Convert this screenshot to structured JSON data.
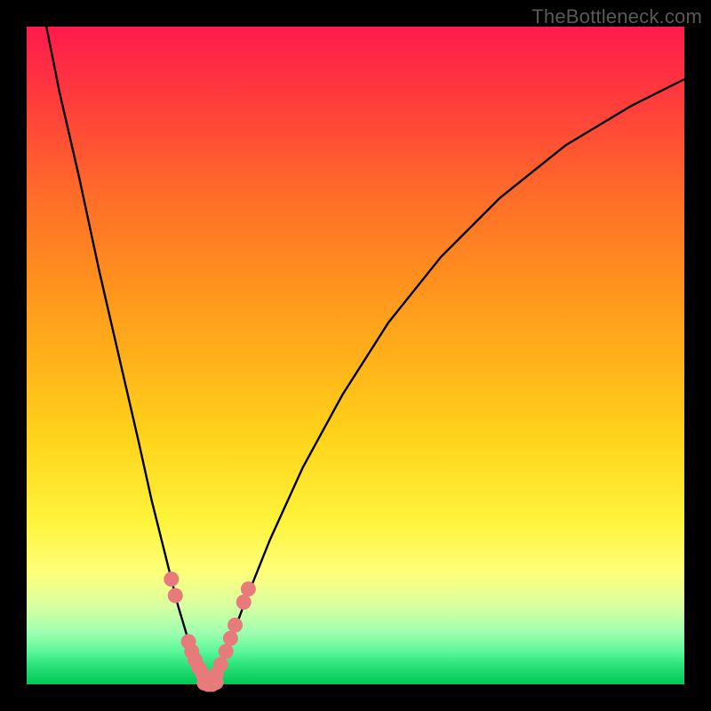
{
  "watermark": "TheBottleneck.com",
  "chart_data": {
    "type": "line",
    "title": "",
    "xlabel": "",
    "ylabel": "",
    "xlim": [
      0,
      100
    ],
    "ylim": [
      0,
      100
    ],
    "series": [
      {
        "name": "bottleneck-left-branch",
        "x": [
          3,
          5,
          8,
          11,
          14,
          17,
          19,
          21,
          23,
          24.5,
          26,
          27,
          28
        ],
        "values": [
          100,
          90,
          77,
          63,
          50,
          37,
          28,
          20,
          12,
          7,
          3,
          1,
          0
        ]
      },
      {
        "name": "bottleneck-right-branch",
        "x": [
          28,
          30,
          33,
          37,
          42,
          48,
          55,
          63,
          72,
          82,
          92,
          100
        ],
        "values": [
          0,
          4,
          12,
          22,
          33,
          44,
          55,
          65,
          74,
          82,
          88,
          92
        ]
      },
      {
        "name": "left-highlight-dots",
        "x": [
          22.0,
          22.6,
          24.6,
          25.1,
          25.6,
          26.2,
          26.8,
          27.4
        ],
        "values": [
          16.0,
          13.5,
          6.5,
          5.0,
          3.7,
          2.5,
          1.5,
          0.6
        ]
      },
      {
        "name": "right-highlight-dots",
        "x": [
          28.2,
          28.8,
          29.5,
          30.3,
          31.0,
          31.7,
          33.0,
          33.7
        ],
        "values": [
          0.5,
          1.5,
          3.0,
          5.0,
          7.0,
          9.0,
          12.5,
          14.5
        ]
      },
      {
        "name": "bottom-highlight-dots",
        "x": [
          27.0,
          27.6,
          28.2,
          28.8
        ],
        "values": [
          0.2,
          0.0,
          0.0,
          0.3
        ]
      }
    ],
    "annotations": [],
    "legend": false,
    "grid": false,
    "colors": {
      "curve": "#000000",
      "dots": "#e77b7b",
      "gradient_top": "#ff1a4d",
      "gradient_bottom": "#00c853"
    }
  }
}
